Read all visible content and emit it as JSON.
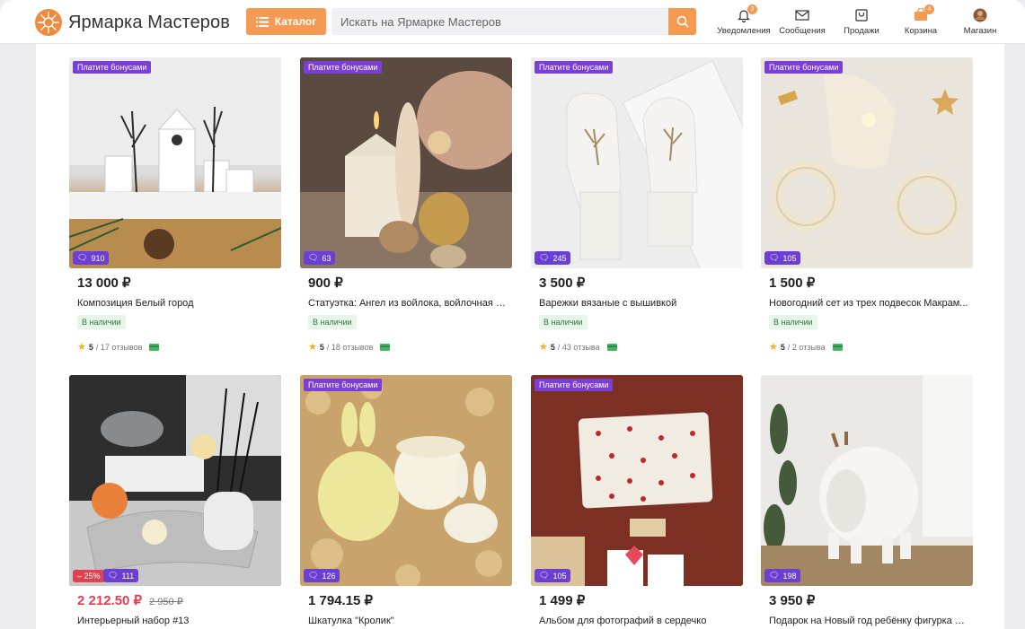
{
  "header": {
    "logo_text": "Ярмарка Мастеров",
    "catalog_label": "Каталог",
    "search_placeholder": "Искать на Ярмарке Мастеров",
    "nav": [
      {
        "label": "Уведомления",
        "icon": "bell-icon",
        "badge": "3"
      },
      {
        "label": "Сообщения",
        "icon": "envelope-icon",
        "badge": ""
      },
      {
        "label": "Продажи",
        "icon": "shop-bag-icon",
        "badge": ""
      },
      {
        "label": "Корзина",
        "icon": "cart-icon",
        "badge": "4"
      },
      {
        "label": "Магазин",
        "icon": "avatar-icon",
        "badge": ""
      }
    ]
  },
  "colors": {
    "accent": "#f49a52",
    "bonus": "#7b3fd6",
    "sale": "#e0414e",
    "stock_bg": "#e7f6e9"
  },
  "products": [
    {
      "price": "13 000 ₽",
      "title": "Композиция Белый город",
      "stock": "В наличии",
      "bonus": "Платите бонусами",
      "reviews_badge": "910",
      "rating": "5",
      "reviews_text": "/ 17 отзывов"
    },
    {
      "price": "900 ₽",
      "title": "Статуэтка: Ангел из войлока, войлочная и...",
      "stock": "В наличии",
      "bonus": "Платите бонусами",
      "reviews_badge": "63",
      "rating": "5",
      "reviews_text": "/ 18 отзывов"
    },
    {
      "price": "3 500 ₽",
      "title": "Варежки вязаные с вышивкой",
      "stock": "В наличии",
      "bonus": "Платите бонусами",
      "reviews_badge": "245",
      "rating": "5",
      "reviews_text": "/ 43 отзыва"
    },
    {
      "price": "1 500 ₽",
      "title": "Новогодний сет из трех подвесок Макрам...",
      "stock": "В наличии",
      "bonus": "Платите бонусами",
      "reviews_badge": "105",
      "rating": "5",
      "reviews_text": "/ 2 отзыва"
    },
    {
      "price": "2 212.50 ₽",
      "old_price": "2 950 ₽",
      "discount": "– 25%",
      "title": "Интерьерный набор #13",
      "reviews_badge": "111"
    },
    {
      "price": "1 794.15 ₽",
      "title": "Шкатулка \"Кролик\"",
      "bonus": "Платите бонусами",
      "reviews_badge": "126"
    },
    {
      "price": "1 499 ₽",
      "title": "Альбом для фотографий в сердечко",
      "bonus": "Платите бонусами",
      "reviews_badge": "105"
    },
    {
      "price": "3 950 ₽",
      "title": "Подарок на Новый год ребёнку фигурка Л...",
      "reviews_badge": "198"
    }
  ]
}
